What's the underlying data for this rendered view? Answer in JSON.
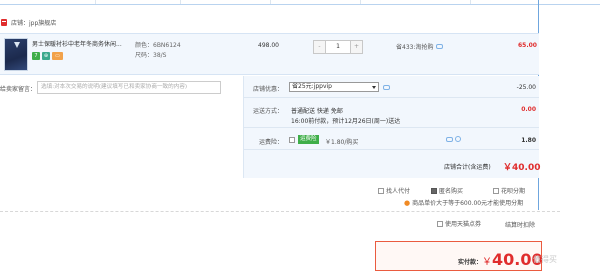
{
  "shop": {
    "name": "店铺：jpp旗舰店"
  },
  "item": {
    "title": "男士保暖衬衫中老年冬商务休闲...",
    "badges": [
      "7",
      "⊕",
      "▭"
    ],
    "sku_color": "颜色：6BN6124",
    "sku_size": "尺码：38/S",
    "price": "498.00",
    "qty": "1",
    "qty_minus": "-",
    "qty_plus": "+",
    "saving": "省433:淘抢购",
    "subtotal": "65.00"
  },
  "message": {
    "label": "给卖家留言：",
    "placeholder": "选填:对本次交易的说明(建议填写已和卖家协商一致的内容)"
  },
  "coupon": {
    "label": "店铺优惠：",
    "selected": "省25元:jppvip",
    "amount": "-25.00"
  },
  "shipping": {
    "label": "运送方式：",
    "method": "普通配送 快递 免邮",
    "note": "16:00前付款，预计12月26日(周一)送达",
    "amount": "0.00"
  },
  "insurance": {
    "label": "运费险：",
    "tag": "运费险",
    "price": "￥1.80/购买",
    "amount": "1.80"
  },
  "store_total": {
    "label": "店铺合计(含运费)",
    "value": "￥40.00"
  },
  "options": {
    "proxy_pay": "找人代付",
    "anonymous": "匿名购买",
    "installment": "花呗分期",
    "note": "商品单价大于等于600.00元才能使用分期",
    "tmall_points": "使用天猫点券",
    "settle": "结算时扣除"
  },
  "payment": {
    "label": "实付款：",
    "currency": "￥",
    "value": "40.00"
  },
  "watermark": "值得买"
}
